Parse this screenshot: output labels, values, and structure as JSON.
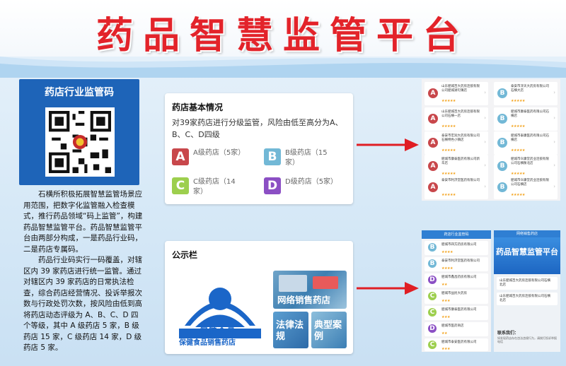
{
  "title": "药品智慧监管平台",
  "qr_card": {
    "title": "药店行业监管码"
  },
  "left_text": {
    "p1": "石横所积极拓展智慧监管场景应用范围，把数字化监管融入检查模式，推行药品领域“码上监管”，构建药品智慧监管平台。药品智慧监管平台由两部分构成，一是药品行业码，二是药店专属码。",
    "p2": "药品行业码实行一码覆盖，对辖区内 39 家药店进行统一监管。通过对辖区内 39 家药店的日常执法检查，综合药店经营情况、投诉举报次数与行政处罚次数，按风险由低到高将药店动态评级为 A、B、C、D 四个等级，其中 A 级药店 5 家，B 级药店 15 家，C 级药店 14 家，D 级药店 5 家。"
  },
  "basic_info": {
    "title": "药店基本情况",
    "desc": "对39家药店进行分级监管，风险由低至高分为A、B、C、D四级",
    "grades": [
      {
        "letter": "A",
        "text": "A级药店（5家）",
        "color": "#c8474b"
      },
      {
        "letter": "B",
        "text": "B级药店（15家）",
        "color": "#72b8d6"
      },
      {
        "letter": "C",
        "text": "C级药店（14家）",
        "color": "#9dcf4e"
      },
      {
        "letter": "D",
        "text": "D级药店（5家）",
        "color": "#8b4fc4"
      }
    ]
  },
  "notice": {
    "title": "公示栏",
    "logo_text": "保健食品",
    "tiles": [
      {
        "label": "保健食品销售药店"
      },
      {
        "label": "网络销售药店"
      },
      {
        "label": "法律法规"
      },
      {
        "label": "典型案例"
      }
    ]
  },
  "phone1": {
    "left_items": [
      {
        "grade": "A",
        "name": "山东肥城百大药房连锁有限公司肥城湖屯镇店"
      },
      {
        "grade": "A",
        "name": "山东肥城百大药房连锁有限公司石横一店"
      },
      {
        "grade": "A",
        "name": "泰安市宏润大药房有限公司石横特色小镇店"
      },
      {
        "grade": "A",
        "name": "肥城市康泰医药有限公司新华店"
      },
      {
        "grade": "A",
        "name": "泰安市利济堂医药有限公司"
      }
    ],
    "right_items": [
      {
        "grade": "B",
        "name": "泰安市淳天大药房有限公司石横大店"
      },
      {
        "grade": "B",
        "name": "肥城市康泰医药有限公司石横店"
      },
      {
        "grade": "B",
        "name": "肥城市泰康医药有限公司石横店"
      },
      {
        "grade": "B",
        "name": "肥城市众康堂药业连锁有限公司石横衡北店"
      },
      {
        "grade": "B",
        "name": "肥城市众康堂药业连锁有限公司石横店"
      }
    ],
    "stars": "★★★★★"
  },
  "phone2": {
    "header": "药店行业监管码",
    "items": [
      {
        "grade": "B",
        "name": "肥城市四方药房有限公司",
        "stars": "★★★★"
      },
      {
        "grade": "B",
        "name": "泰安市利济堂医药有限公司",
        "stars": "★★★★"
      },
      {
        "grade": "D",
        "name": "肥城市鑫昌药房有限公司",
        "stars": "★★"
      },
      {
        "grade": "C",
        "name": "肥城市益民大药房",
        "stars": "★★★"
      },
      {
        "grade": "C",
        "name": "肥城市康泰医药有限公司",
        "stars": "★★★"
      },
      {
        "grade": "D",
        "name": "肥城市医药商店",
        "stars": "★★"
      },
      {
        "grade": "C",
        "name": "肥城市泰安医药有限公司",
        "stars": "★★★"
      }
    ]
  },
  "phone3": {
    "header": "网络销售药店",
    "banner": "药品智慧监管平台",
    "items": [
      {
        "name": "山东肥城百大药房连锁有限公司石横北店"
      },
      {
        "name": "山东肥城百大药房连锁有限公司石横北店"
      }
    ],
    "contact_title": "联系我们：",
    "contact_text": "如发现药店存在违法违规行为，请拨打投诉举报电话"
  },
  "colors": {
    "title_red": "#e3232a",
    "qr_blue": "#1e64b8",
    "arrow_red": "#e01e24"
  }
}
